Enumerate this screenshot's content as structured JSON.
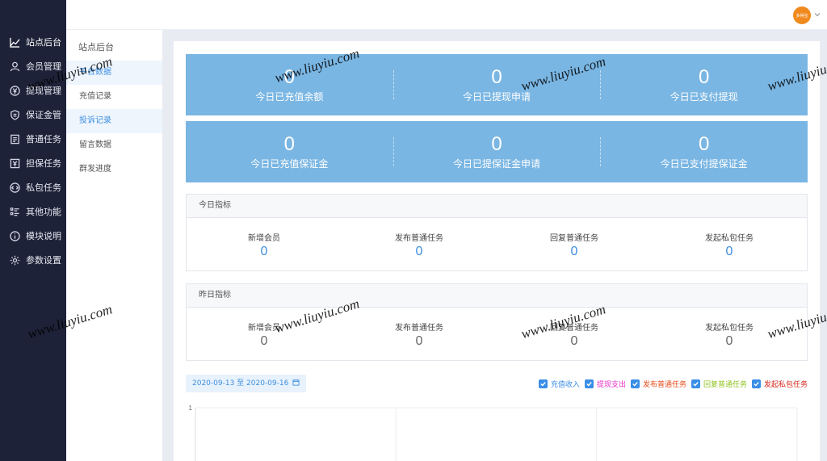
{
  "nav": {
    "items": [
      {
        "label": "站点后台",
        "icon": "chart-line-icon",
        "active": true
      },
      {
        "label": "会员管理",
        "icon": "user-icon"
      },
      {
        "label": "提现管理",
        "icon": "yen-circle-icon"
      },
      {
        "label": "保证金管",
        "icon": "shield-icon"
      },
      {
        "label": "普通任务",
        "icon": "task-icon"
      },
      {
        "label": "担保任务",
        "icon": "yen-box-icon"
      },
      {
        "label": "私包任务",
        "icon": "code-circle-icon"
      },
      {
        "label": "其他功能",
        "icon": "list-icon"
      },
      {
        "label": "模块说明",
        "icon": "info-icon"
      },
      {
        "label": "参数设置",
        "icon": "gear-icon"
      }
    ]
  },
  "header": {
    "avatar_text": "多得宝"
  },
  "subnav": {
    "title": "站点后台",
    "items": [
      "平台数据",
      "充值记录",
      "投诉记录",
      "留言数据",
      "群发进度"
    ]
  },
  "stats_row1": [
    {
      "value": "0",
      "label": "今日已充值余额"
    },
    {
      "value": "0",
      "label": "今日已提现申请"
    },
    {
      "value": "0",
      "label": "今日已支付提现"
    }
  ],
  "stats_row2": [
    {
      "value": "0",
      "label": "今日已充值保证金"
    },
    {
      "value": "0",
      "label": "今日已提保证金申请"
    },
    {
      "value": "0",
      "label": "今日已支付提保证金"
    }
  ],
  "today": {
    "title": "今日指标",
    "metrics": [
      {
        "label": "新增会员",
        "value": "0"
      },
      {
        "label": "发布普通任务",
        "value": "0"
      },
      {
        "label": "回复普通任务",
        "value": "0"
      },
      {
        "label": "发起私包任务",
        "value": "0"
      }
    ]
  },
  "yesterday": {
    "title": "昨日指标",
    "metrics": [
      {
        "label": "新增会员",
        "value": "0"
      },
      {
        "label": "发布普通任务",
        "value": "0"
      },
      {
        "label": "回复普通任务",
        "value": "0"
      },
      {
        "label": "发起私包任务",
        "value": "0"
      }
    ]
  },
  "date_range": "2020-09-13 至 2020-09-16",
  "legend": [
    {
      "label": "充值收入",
      "color": "#3a8ee6",
      "checked": true
    },
    {
      "label": "提现支出",
      "color": "#e62ec8",
      "checked": true
    },
    {
      "label": "发布普通任务",
      "color": "#e64a19",
      "checked": true
    },
    {
      "label": "回复普通任务",
      "color": "#8fc31f",
      "checked": true
    },
    {
      "label": "发起私包任务",
      "color": "#d9261c",
      "checked": true
    }
  ],
  "chart_data": {
    "type": "line",
    "y_ticks": [
      "1"
    ],
    "ylim": [
      0,
      1
    ],
    "series": []
  },
  "watermark": "www.liuyiu.com"
}
